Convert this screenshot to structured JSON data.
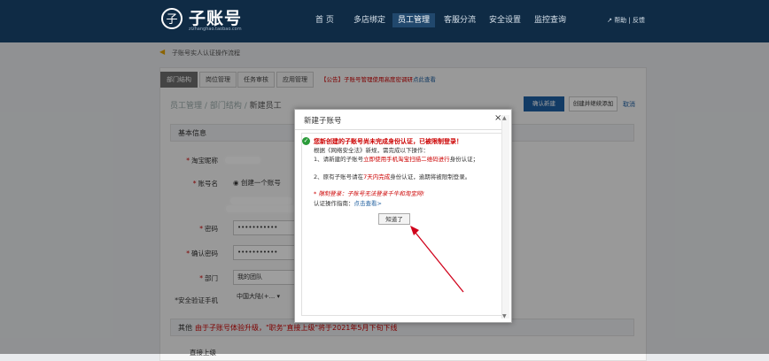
{
  "header": {
    "logo_mark": "子",
    "logo_title": "子账号",
    "logo_subtitle": "zizhanghao.taobao.com",
    "nav": [
      {
        "label": "首 页"
      },
      {
        "label": "多店绑定"
      },
      {
        "label": "员工管理"
      },
      {
        "label": "客服分流"
      },
      {
        "label": "安全设置"
      },
      {
        "label": "监控查询"
      }
    ],
    "help_text": "帮助 | 反馈"
  },
  "notice": {
    "text": "子账号实人认证操作流程"
  },
  "tabs": [
    {
      "label": "部门结构"
    },
    {
      "label": "岗位管理"
    },
    {
      "label": "任务审核"
    },
    {
      "label": "应用管理"
    }
  ],
  "announcement": {
    "text": "【公告】子账号管理使用高度密调研",
    "link": "点此查看"
  },
  "breadcrumb": {
    "part1": "员工管理",
    "sep": "/",
    "part2": "部门结构",
    "part3": "新建员工"
  },
  "actions": {
    "confirm": "确认新建",
    "create_and_add": "创建并继续添加",
    "cancel": "取消"
  },
  "section_basic": "基本信息",
  "form": {
    "nickname_label": "淘宝昵称",
    "account_label": "账号名",
    "account_radio": "创建一个账号",
    "password_label": "密码",
    "password_value": "•••••••••••",
    "confirm_password_label": "确认密码",
    "confirm_password_value": "•••••••••••",
    "dept_label": "部门",
    "dept_value": "我的团队",
    "phone_label": "*安全验证手机",
    "phone_value": "中国大陆(+..."
  },
  "section_other": "其他",
  "other_note": "由于子账号体验升级，\"职务\"直接上级\"将于2021年5月下旬下线",
  "direct_boss_label": "直接上级",
  "modal": {
    "title": "新建子账号",
    "close": "×",
    "headline": "您新创建的子账号尚未完成身份认证，已被限制登录！",
    "line1": "根据《网络安全法》新规，需完成以下操作：",
    "line2a": "1、请新建的子账号",
    "line2b": "立即使用手机淘宝扫描二维码进行",
    "line2c": "身份认证；",
    "line3a": "2、原有子账号请在",
    "line3b": "7天内完成",
    "line3c": "身份认证，逾期将被限制登录。",
    "warn": "* 限制登录：子账号无法登录千牛和淘宝网!",
    "guide_prefix": "认证操作指南：",
    "guide_link": "点击查看>",
    "ok": "知道了"
  },
  "colors": {
    "header_bg": "#0f2b45",
    "primary": "#1e5fa3",
    "warning_red": "#cc0000",
    "annotation_arrow": "#d0021b"
  }
}
